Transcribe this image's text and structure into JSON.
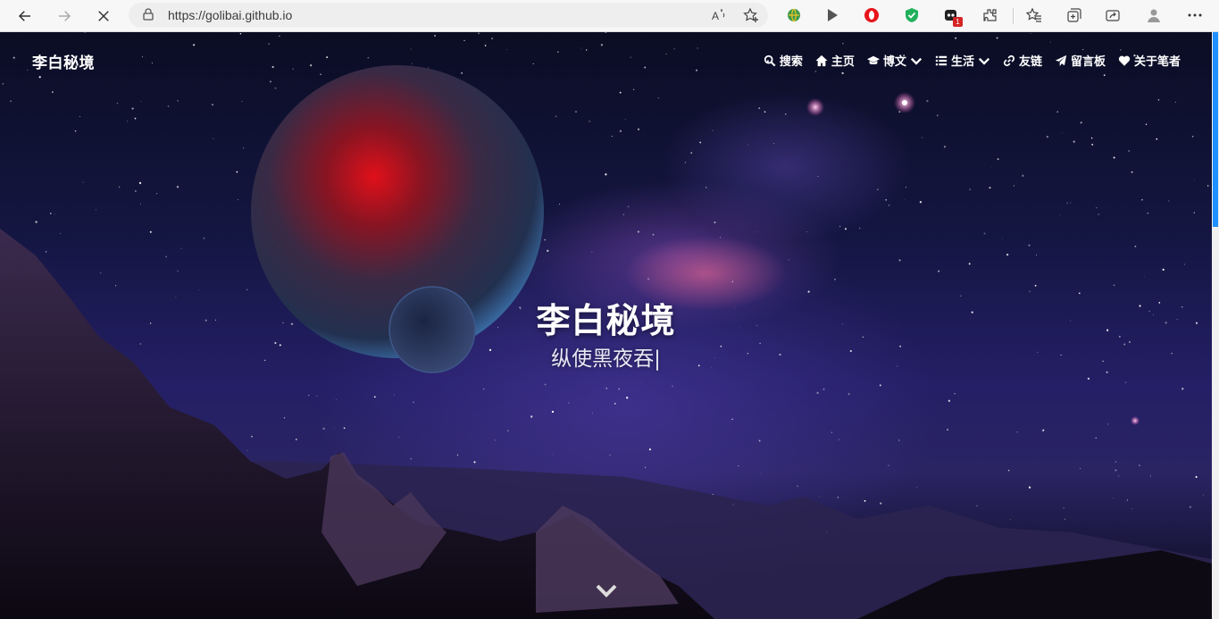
{
  "browser": {
    "url": "https://golibai.github.io",
    "badge_count": "1",
    "icons": [
      "back-icon",
      "forward-icon",
      "stop-icon",
      "lock-icon",
      "read-aloud-icon",
      "add-favorite-icon",
      "extension-globe-icon",
      "extension-play-icon",
      "extension-opera-icon",
      "extension-shield-icon",
      "extension-badge-icon",
      "extensions-icon",
      "favorites-icon",
      "collections-icon",
      "share-icon",
      "profile-icon",
      "more-icon"
    ]
  },
  "site": {
    "title": "李白秘境",
    "nav": [
      {
        "label": "搜索",
        "icon": "search-icon"
      },
      {
        "label": "主页",
        "icon": "home-icon"
      },
      {
        "label": "博文",
        "icon": "graduation-cap-icon",
        "dropdown": true
      },
      {
        "label": "生活",
        "icon": "list-icon",
        "dropdown": true
      },
      {
        "label": "友链",
        "icon": "link-icon"
      },
      {
        "label": "留言板",
        "icon": "paper-plane-icon"
      },
      {
        "label": "关于笔者",
        "icon": "heart-icon"
      }
    ]
  },
  "hero": {
    "title": "李白秘境",
    "subtitle": "纵使黑夜吞|"
  },
  "colors": {
    "accent": "#1e90ff",
    "text": "#ffffff",
    "sky_top": "#0b0d24",
    "nebula_pink": "#ff6e96"
  }
}
